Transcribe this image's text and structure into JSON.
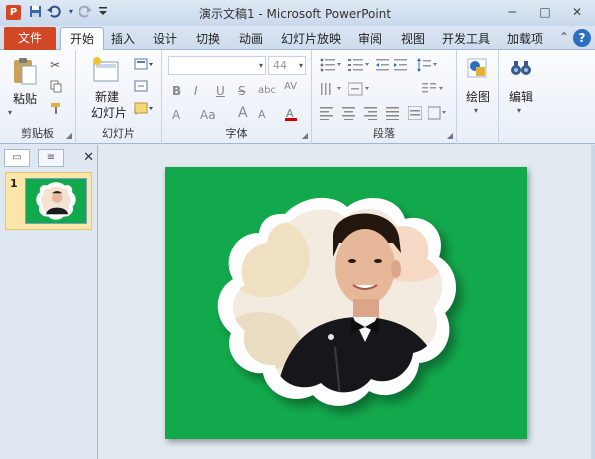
{
  "titlebar": {
    "title": "演示文稿1 - Microsoft PowerPoint",
    "app_logo": "P",
    "minimize": "─",
    "maximize": "□",
    "close": "✕"
  },
  "tabs": {
    "file": "文件",
    "items": [
      "开始",
      "插入",
      "设计",
      "切换",
      "动画",
      "幻灯片放映",
      "审阅",
      "视图",
      "开发工具",
      "加载项"
    ],
    "active": "开始",
    "help": "?"
  },
  "ribbon": {
    "clipboard": {
      "paste": "粘贴",
      "group": "剪贴板"
    },
    "slides": {
      "new_slide_line1": "新建",
      "new_slide_line2": "幻灯片",
      "group": "幻灯片"
    },
    "font": {
      "font_size": "44",
      "bold": "B",
      "italic": "I",
      "underline": "U",
      "strike": "S",
      "shadow": "abc",
      "spacing": "AV",
      "clear": "A",
      "case": "Aa",
      "grow": "A",
      "shrink": "A",
      "group": "字体"
    },
    "paragraph": {
      "group": "段落"
    },
    "drawing": {
      "label": "绘图"
    },
    "editing": {
      "label": "编辑"
    }
  },
  "leftpane": {
    "slide_number": "1"
  },
  "colors": {
    "file_tab": "#d24726",
    "slide_bg": "#12a94c",
    "ribbon_accent": "#2c6fc2"
  }
}
